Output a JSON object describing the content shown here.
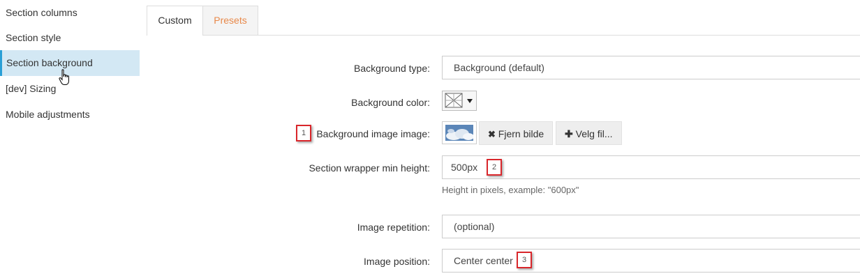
{
  "sidebar": {
    "items": [
      {
        "label": "Section columns"
      },
      {
        "label": "Section style"
      },
      {
        "label": "Section background"
      },
      {
        "label": "[dev] Sizing"
      },
      {
        "label": "Mobile adjustments"
      }
    ],
    "active_color": "#d3e8f4"
  },
  "tabs": [
    {
      "label": "Custom"
    },
    {
      "label": "Presets"
    }
  ],
  "form": {
    "background_type": {
      "label": "Background type:",
      "value": "Background (default)"
    },
    "background_color": {
      "label": "Background color:",
      "icon": "no-color-icon"
    },
    "background_image": {
      "label": "Background image image:",
      "remove_button": "Fjern bilde",
      "choose_button": "Velg fil..."
    },
    "min_height": {
      "label": "Section wrapper min height:",
      "value": "500px",
      "help": "Height in pixels, example: \"600px\""
    },
    "image_repetition": {
      "label": "Image repetition:",
      "value": "(optional)"
    },
    "image_position": {
      "label": "Image position:",
      "value": "Center center"
    }
  },
  "markers": [
    "1",
    "2",
    "3"
  ],
  "colors": {
    "accent": "#2a9fd6",
    "presets_tab": "#e8894a",
    "marker_border": "#d9262b"
  }
}
